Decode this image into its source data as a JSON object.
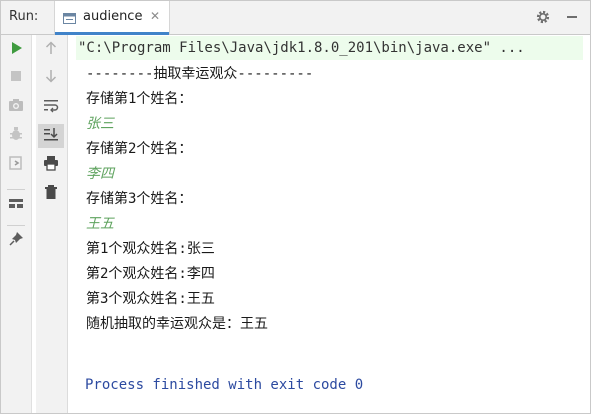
{
  "header": {
    "run_label": "Run:",
    "tab_title": "audience"
  },
  "console": {
    "command": "\"C:\\Program Files\\Java\\jdk1.8.0_201\\bin\\java.exe\" ...",
    "lines": [
      {
        "text": "--------抽取幸运观众---------",
        "kind": "out"
      },
      {
        "text": "存储第1个姓名：",
        "kind": "out"
      },
      {
        "text": "张三",
        "kind": "in"
      },
      {
        "text": "存储第2个姓名：",
        "kind": "out"
      },
      {
        "text": "李四",
        "kind": "in"
      },
      {
        "text": "存储第3个姓名：",
        "kind": "out"
      },
      {
        "text": "王五",
        "kind": "in"
      },
      {
        "text": "第1个观众姓名:张三",
        "kind": "out"
      },
      {
        "text": "第2个观众姓名:李四",
        "kind": "out"
      },
      {
        "text": "第3个观众姓名:王五",
        "kind": "out"
      },
      {
        "text": "随机抽取的幸运观众是：王五",
        "kind": "out"
      }
    ],
    "exit_message": "Process finished with exit code 0"
  },
  "icons": {
    "left_toolbar": [
      "run-icon",
      "stop-icon",
      "camera-icon",
      "debug-bug-icon",
      "restore-layout-icon",
      "layout-icon",
      "pin-icon"
    ],
    "right_toolbar": [
      "arrow-up-icon",
      "arrow-down-icon",
      "soft-wrap-icon",
      "scroll-to-end-icon",
      "print-icon",
      "trash-icon"
    ],
    "header": [
      "settings-gear-icon",
      "minimize-icon"
    ]
  },
  "colors": {
    "accent": "#4083c9",
    "input_text": "#5fa35f",
    "exit_text": "#2c4aa0",
    "command_bg": "#edfcec",
    "run_green": "#3f9b3f"
  }
}
